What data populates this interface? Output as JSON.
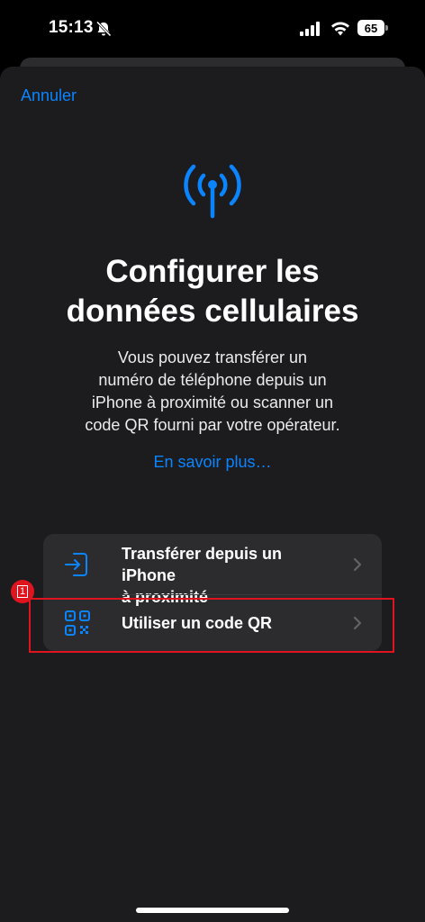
{
  "status_bar": {
    "time": "15:13",
    "battery": "65"
  },
  "nav": {
    "cancel_label": "Annuler"
  },
  "main": {
    "title_line1": "Configurer les",
    "title_line2": "données cellulaires",
    "description_line1": "Vous pouvez transférer un",
    "description_line2": "numéro de téléphone depuis un",
    "description_line3": "iPhone à proximité ou scanner un",
    "description_line4": "code QR fourni par votre opérateur.",
    "learn_more": "En savoir plus…"
  },
  "options": [
    {
      "label_line1": "Transférer depuis un iPhone",
      "label_line2": "à proximité",
      "icon": "transfer-phone-icon"
    },
    {
      "label": "Utiliser un code QR",
      "icon": "qr-code-icon"
    }
  ],
  "annotation": {
    "marker": "1"
  },
  "colors": {
    "accent": "#0a84ff",
    "sheet_bg": "#1c1c1e",
    "card_bg": "#2c2c2e",
    "highlight": "#e0141e"
  }
}
